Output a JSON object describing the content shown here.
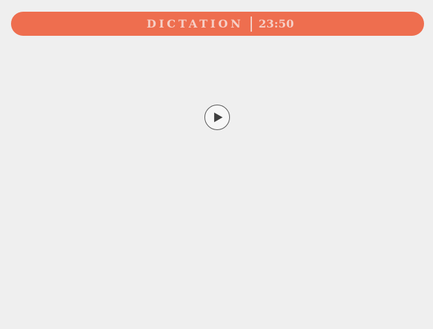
{
  "header": {
    "title": "DICTATION",
    "time": "23:50"
  },
  "player": {
    "play_icon": "play-icon"
  },
  "colors": {
    "accent": "#ee6e4f",
    "background": "#efefef",
    "header_text": "#f6cfc6",
    "icon": "#3f3f3f"
  }
}
